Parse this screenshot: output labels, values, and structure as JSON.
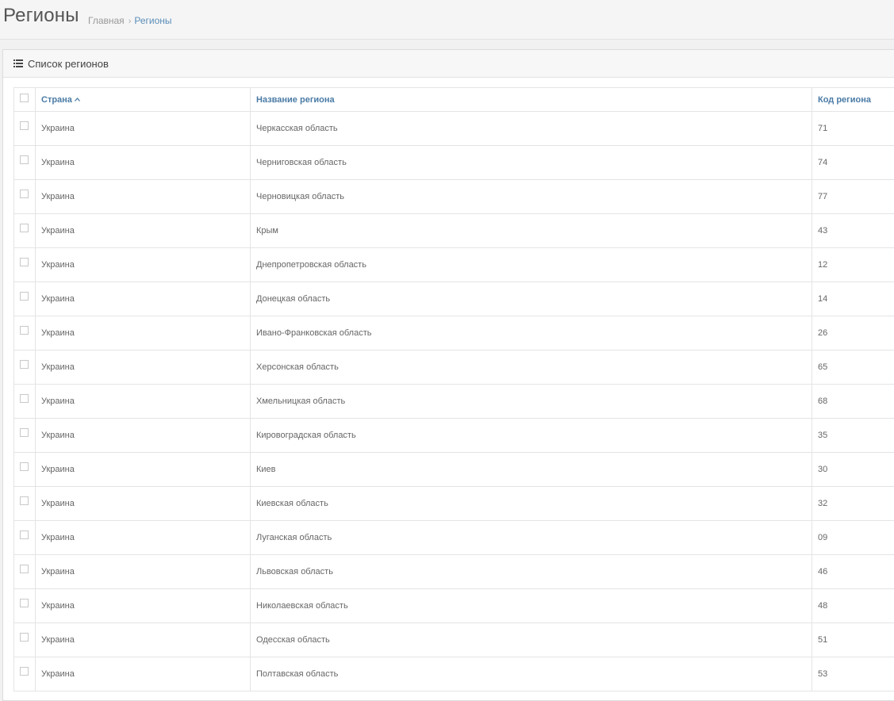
{
  "header": {
    "title": "Регионы",
    "breadcrumb": {
      "home": "Главная",
      "separator": "›",
      "current": "Регионы"
    }
  },
  "box": {
    "icon": "list-icon",
    "title": "Список регионов"
  },
  "table": {
    "columns": {
      "country": "Страна",
      "country_sort_icon": "^",
      "name": "Название региона",
      "code": "Код региона"
    },
    "rows": [
      {
        "country": "Украина",
        "name": "Черкасская область",
        "code": "71"
      },
      {
        "country": "Украина",
        "name": "Черниговская область",
        "code": "74"
      },
      {
        "country": "Украина",
        "name": "Черновицкая область",
        "code": "77"
      },
      {
        "country": "Украина",
        "name": "Крым",
        "code": "43"
      },
      {
        "country": "Украина",
        "name": "Днепропетровская область",
        "code": "12"
      },
      {
        "country": "Украина",
        "name": "Донецкая область",
        "code": "14"
      },
      {
        "country": "Украина",
        "name": "Ивано-Франковская область",
        "code": "26"
      },
      {
        "country": "Украина",
        "name": "Херсонская область",
        "code": "65"
      },
      {
        "country": "Украина",
        "name": "Хмельницкая область",
        "code": "68"
      },
      {
        "country": "Украина",
        "name": "Кировоградская область",
        "code": "35"
      },
      {
        "country": "Украина",
        "name": "Киев",
        "code": "30"
      },
      {
        "country": "Украина",
        "name": "Киевская область",
        "code": "32"
      },
      {
        "country": "Украина",
        "name": "Луганская область",
        "code": "09"
      },
      {
        "country": "Украина",
        "name": "Львовская область",
        "code": "46"
      },
      {
        "country": "Украина",
        "name": "Николаевская область",
        "code": "48"
      },
      {
        "country": "Украина",
        "name": "Одесская область",
        "code": "51"
      },
      {
        "country": "Украина",
        "name": "Полтавская область",
        "code": "53"
      }
    ]
  },
  "colors": {
    "accent": "#4a7ba6",
    "breadcrumb_current": "#5b8db8"
  }
}
